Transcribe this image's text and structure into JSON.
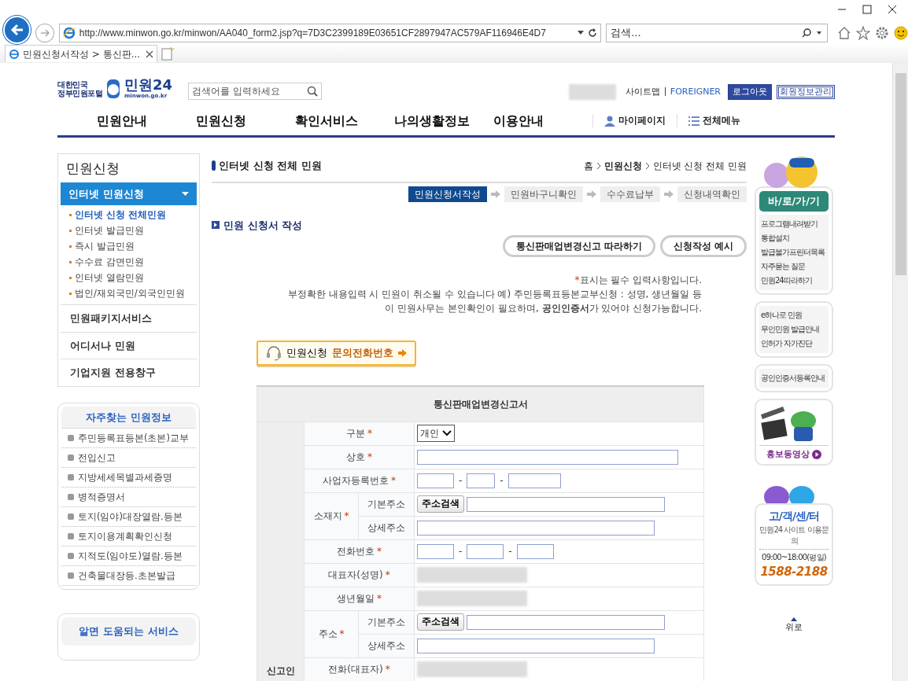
{
  "browser": {
    "url": "http://www.minwon.go.kr/minwon/AA040_form2.jsp?q=7D3C2399189E03651CF2897947AC579AF116946E4D7",
    "search_placeholder": "검색...",
    "tab_title": "민원신청서작성 > 통신판..."
  },
  "header": {
    "logo_line1": "대한민국",
    "logo_line2": "정부민원포털",
    "logo_name": "민원24",
    "logo_domain": "minwon.go.kr",
    "search_placeholder": "검색어를 입력하세요",
    "links": [
      "사이트맵",
      "FOREIGNER"
    ],
    "logout": "로그아웃",
    "member": "회원정보관리"
  },
  "nav": {
    "items": [
      "민원안내",
      "민원신청",
      "확인서비스",
      "나의생활정보",
      "이용안내"
    ],
    "utility": [
      {
        "label": "마이페이지",
        "kind": "user"
      },
      {
        "label": "전체메뉴",
        "kind": "menu"
      }
    ]
  },
  "sidebar": {
    "title": "민원신청",
    "menu": [
      {
        "label": "인터넷 민원신청",
        "selected": true,
        "expanded": true,
        "children": [
          {
            "label": "인터넷 신청 전체민원",
            "selected": true
          },
          {
            "label": "인터넷 발급민원",
            "selected": false
          },
          {
            "label": "즉시 발급민원",
            "selected": false
          },
          {
            "label": "수수료 감면민원",
            "selected": false
          },
          {
            "label": "인터넷 열람민원",
            "selected": false
          },
          {
            "label": "법인/재외국민/외국인민원",
            "selected": false
          }
        ]
      },
      {
        "label": "민원패키지서비스",
        "selected": false,
        "expanded": false
      },
      {
        "label": "어디서나 민원",
        "selected": false,
        "expanded": false
      },
      {
        "label": "기업지원 전용창구",
        "selected": false,
        "expanded": false
      }
    ]
  },
  "frequent": {
    "title": "자주찾는 민원정보",
    "items": [
      "주민등록표등본(초본)교부",
      "전입신고",
      "지방세세목별과세증명",
      "병적증명서",
      "토지(임야)대장열람.등본",
      "토지이용계획확인신청",
      "지적도(임야도)열람.등본",
      "건축물대장등.초본발급"
    ]
  },
  "helpful": {
    "title": "알면 도움되는 서비스"
  },
  "main": {
    "title": "인터넷 신청 전체 민원",
    "breadcrumb": [
      "홈",
      "민원신청",
      "인터넷 신청 전체 민원"
    ],
    "steps": [
      {
        "label": "민원신청서작성",
        "selected": true
      },
      {
        "label": "민원바구니확인",
        "selected": false
      },
      {
        "label": "수수료납부",
        "selected": false
      },
      {
        "label": "신청내역확인",
        "selected": false
      }
    ],
    "section_title": "민원 신청서 작성",
    "guide_buttons": [
      "통신판매업변경신고 따라하기",
      "신청작성 예시"
    ],
    "notes": [
      {
        "mark": "*",
        "text": "표시는 필수 입력사항입니다."
      },
      {
        "text": "부정확한 내용입력 시 민원이 취소될 수 있습니다  예) 주민등록표등본교부신청 : 성명, 생년월일 등"
      },
      {
        "text": "이 민원사무는 본인확인이 필요하며, **공인인증서**가 있어야 신청가능합니다."
      }
    ],
    "phone_button": {
      "label": "민원신청",
      "highlight": "문의전화번호"
    }
  },
  "form": {
    "title": "통신판매업변경신고서",
    "group": "신고인",
    "rows": [
      {
        "kind": "select",
        "label": "구분",
        "mark": "*",
        "value": "개인"
      },
      {
        "kind": "text",
        "label": "상호",
        "mark": "*"
      },
      {
        "kind": "triple",
        "label": "사업자등록번호",
        "mark": "*",
        "separators": [
          "-",
          "-"
        ]
      },
      {
        "kind": "address",
        "label": "소재지",
        "mark": "*",
        "parts": [
          {
            "label": "기본주소",
            "button": "주소검색"
          },
          {
            "label": "상세주소"
          }
        ]
      },
      {
        "kind": "triple",
        "label": "전화번호",
        "mark": "*",
        "separators": [
          "-",
          "-"
        ]
      },
      {
        "kind": "blurred",
        "label": "대표자(성명)",
        "mark": "*"
      },
      {
        "kind": "blurred",
        "label": "생년월일",
        "mark": "*"
      },
      {
        "kind": "address",
        "label": "주소",
        "mark": "*",
        "parts": [
          {
            "label": "기본주소",
            "button": "주소검색"
          },
          {
            "label": "상세주소"
          }
        ]
      },
      {
        "kind": "blurred",
        "label": "전화(대표자)",
        "mark": "*"
      }
    ]
  },
  "right": {
    "quick": {
      "title": "바/로/가/기",
      "items": [
        "프로그램내려받기",
        "통합설치",
        "발급불가프린터목록",
        "자주묻는 질문",
        "민원24따라하기"
      ]
    },
    "links_a": [
      "e하나로 민원",
      "무인민원 발급안내",
      "인허가 자가진단"
    ],
    "links_b": [
      "공인인증서등록안내"
    ],
    "video": "홍보동영상",
    "center": {
      "title": "고/객/센/터",
      "subtitle": "민원24 사이트 이용문의",
      "hours": "09:00~18:00(평일)",
      "phone": "1588-2188"
    },
    "top_link": "위로"
  }
}
